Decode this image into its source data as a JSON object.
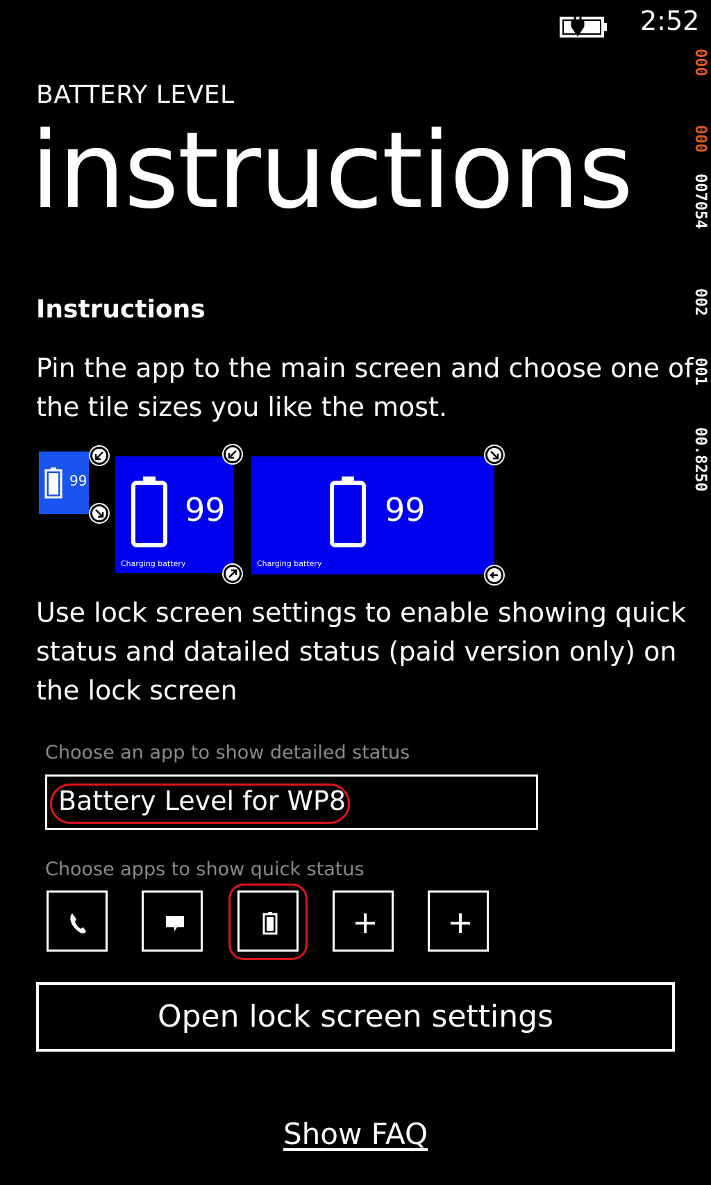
{
  "status_bar": {
    "time": "2:52",
    "battery_icon": "charging-battery-icon"
  },
  "debug_counter": {
    "values": [
      "000",
      "000",
      "007054",
      "002",
      "001",
      "00.8250"
    ],
    "colors": [
      "#e05a1e",
      "#e05a1e",
      "#ffffff",
      "#ffffff",
      "#ffffff",
      "#ffffff"
    ]
  },
  "header": {
    "app_title": "BATTERY LEVEL",
    "page_title": "instructions"
  },
  "content": {
    "heading": "Instructions",
    "pin_text": "Pin the app to the main screen and choose one of the tile sizes you like the most.",
    "lock_text": "Use lock screen settings to enable showing quick status and datailed status (paid version only) on the lock screen"
  },
  "tiles": {
    "small": {
      "value": "99"
    },
    "medium": {
      "value": "99",
      "caption": "Charging battery"
    },
    "wide": {
      "value": "99",
      "caption": "Charging battery"
    },
    "accent_color": "#0000f0"
  },
  "detailed_status": {
    "label": "Choose an app to show detailed status",
    "value": "Battery Level for WP8"
  },
  "quick_status": {
    "label": "Choose apps to show quick status",
    "slots": [
      "phone-icon",
      "message-icon",
      "battery-icon",
      "plus-icon",
      "plus-icon"
    ]
  },
  "buttons": {
    "lock_settings": "Open lock screen settings",
    "faq": "Show FAQ"
  },
  "highlight_color": "#e0141e"
}
